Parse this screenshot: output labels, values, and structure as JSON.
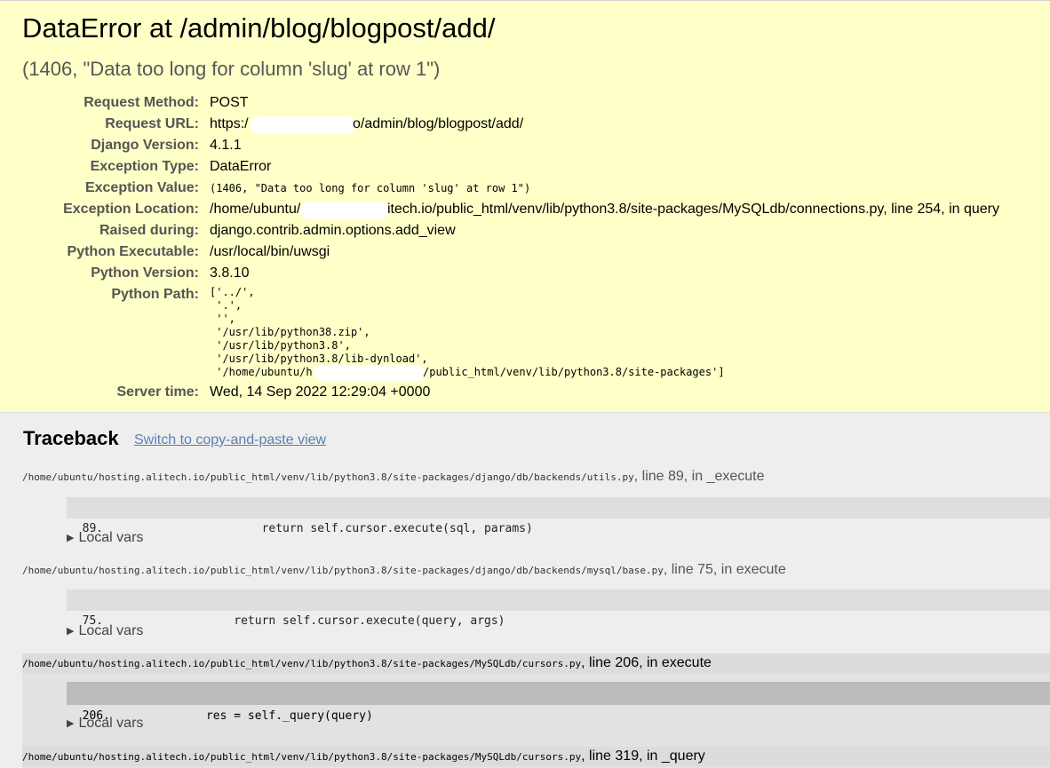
{
  "header": {
    "title": "DataError at /admin/blog/blogpost/add/",
    "subtitle": "(1406, \"Data too long for column 'slug' at row 1\")"
  },
  "meta": {
    "request_method_label": "Request Method:",
    "request_method": "POST",
    "request_url_label": "Request URL:",
    "request_url_start": "https:/",
    "request_url_end": "o/admin/blog/blogpost/add/",
    "django_version_label": "Django Version:",
    "django_version": "4.1.1",
    "exception_type_label": "Exception Type:",
    "exception_type": "DataError",
    "exception_value_label": "Exception Value:",
    "exception_value": "(1406, \"Data too long for column 'slug' at row 1\")",
    "exception_location_label": "Exception Location:",
    "exception_location_start": "/home/ubuntu/",
    "exception_location_end": "itech.io/public_html/venv/lib/python3.8/site-packages/MySQLdb/connections.py, line 254, in query",
    "raised_during_label": "Raised during:",
    "raised_during": "django.contrib.admin.options.add_view",
    "python_executable_label": "Python Executable:",
    "python_executable": "/usr/local/bin/uwsgi",
    "python_version_label": "Python Version:",
    "python_version": "3.8.10",
    "python_path_label": "Python Path:",
    "python_path_lines": [
      "['../',",
      " '.',",
      " '',",
      " '/usr/lib/python38.zip',",
      " '/usr/lib/python3.8',",
      " '/usr/lib/python3.8/lib-dynload',",
      " '/home/ubuntu/h",
      "/public_html/venv/lib/python3.8/site-packages']"
    ],
    "server_time_label": "Server time:",
    "server_time": "Wed, 14 Sep 2022 12:29:04 +0000"
  },
  "traceback": {
    "title": "Traceback",
    "copy_link": "Switch to copy-and-paste view",
    "local_vars_label": "Local vars",
    "frames": [
      {
        "path": "/home/ubuntu/hosting.alitech.io/public_html/venv/lib/python3.8/site-packages/django/db/backends/utils.py",
        "tail": ", line 89, in _execute",
        "line_no": "89.",
        "code": "            return self.cursor.execute(sql, params)"
      },
      {
        "path": "/home/ubuntu/hosting.alitech.io/public_html/venv/lib/python3.8/site-packages/django/db/backends/mysql/base.py",
        "tail": ", line 75, in execute",
        "line_no": "75.",
        "code": "        return self.cursor.execute(query, args)"
      },
      {
        "path": "/home/ubuntu/hosting.alitech.io/public_html/venv/lib/python3.8/site-packages/MySQLdb/cursors.py",
        "tail": ", line 206, in execute",
        "line_no": "206.",
        "code": "    res = self._query(query)"
      },
      {
        "path": "/home/ubuntu/hosting.alitech.io/public_html/venv/lib/python3.8/site-packages/MySQLdb/cursors.py",
        "tail": ", line 319, in _query"
      }
    ]
  },
  "colors": {
    "summary_bg": "#ffffc8",
    "page_bg": "#eeeeee",
    "link": "#5b80b2",
    "user_frame_bg": "#e2e2e2",
    "user_code_bg": "#bbbbbb"
  }
}
